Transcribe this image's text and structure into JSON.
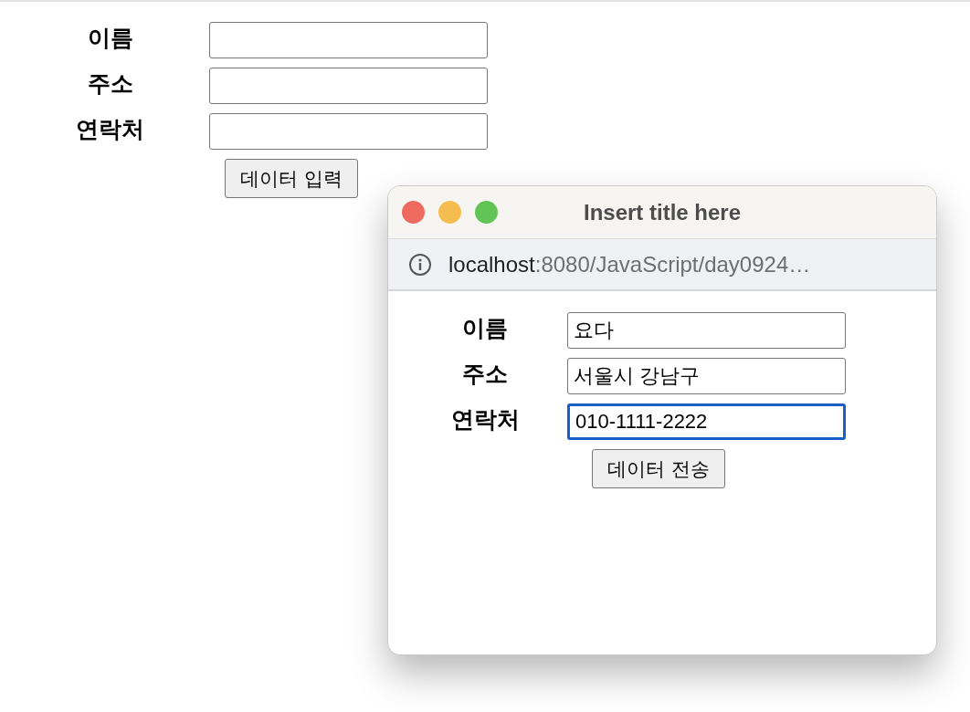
{
  "page": {
    "fields": [
      {
        "label": "이름"
      },
      {
        "label": "주소"
      },
      {
        "label": "연락처"
      }
    ],
    "button": "데이터 입력"
  },
  "popup": {
    "title": "Insert title here",
    "url": {
      "host": "localhost",
      "path": ":8080/JavaScript/day0924…"
    },
    "fields": [
      {
        "label": "이름",
        "value": "요다",
        "focused": false
      },
      {
        "label": "주소",
        "value": "서울시 강남구",
        "focused": false
      },
      {
        "label": "연락처",
        "value": "010-1111-2222",
        "focused": true
      }
    ],
    "button": "데이터 전송"
  }
}
